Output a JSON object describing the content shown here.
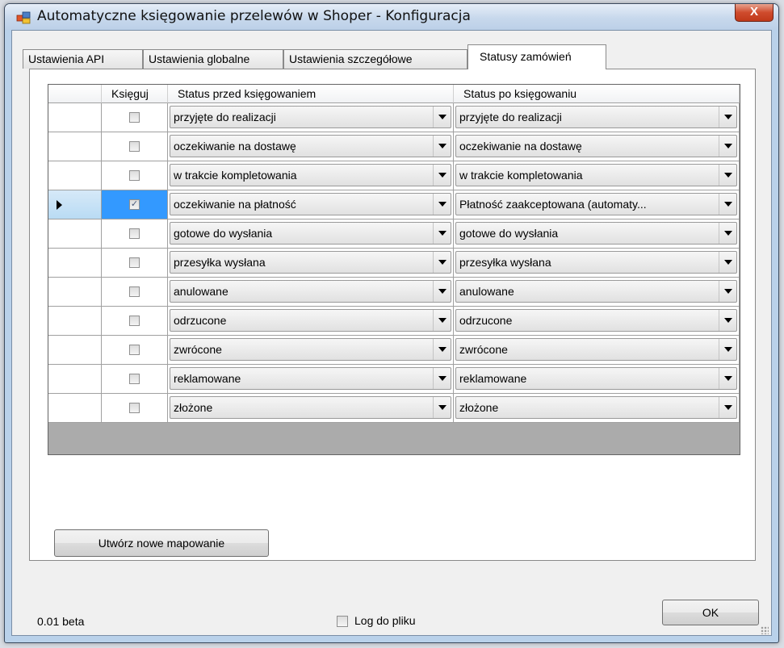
{
  "window": {
    "title": "Automatyczne księgowanie przelewów w Shoper - Konfiguracja",
    "close_label": "X",
    "accent": "#3399ff"
  },
  "tabs": [
    {
      "label": "Ustawienia API",
      "active": false
    },
    {
      "label": "Ustawienia globalne",
      "active": false
    },
    {
      "label": "Ustawienia szczegółowe",
      "active": false
    },
    {
      "label": "Statusy zamówień",
      "active": true
    }
  ],
  "grid": {
    "columns": [
      "Księguj",
      "Status przed księgowaniem",
      "Status po księgowaniu"
    ],
    "rows": [
      {
        "checked": false,
        "selected": false,
        "before": "przyjęte do realizacji",
        "after": "przyjęte do realizacji"
      },
      {
        "checked": false,
        "selected": false,
        "before": "oczekiwanie na dostawę",
        "after": "oczekiwanie na dostawę"
      },
      {
        "checked": false,
        "selected": false,
        "before": "w trakcie kompletowania",
        "after": "w trakcie kompletowania"
      },
      {
        "checked": true,
        "selected": true,
        "before": "oczekiwanie na płatność",
        "after": "Płatność zaakceptowana (automaty..."
      },
      {
        "checked": false,
        "selected": false,
        "before": "gotowe do wysłania",
        "after": "gotowe do wysłania"
      },
      {
        "checked": false,
        "selected": false,
        "before": "przesyłka wysłana",
        "after": "przesyłka wysłana"
      },
      {
        "checked": false,
        "selected": false,
        "before": "anulowane",
        "after": "anulowane"
      },
      {
        "checked": false,
        "selected": false,
        "before": "odrzucone",
        "after": "odrzucone"
      },
      {
        "checked": false,
        "selected": false,
        "before": "zwrócone",
        "after": "zwrócone"
      },
      {
        "checked": false,
        "selected": false,
        "before": "reklamowane",
        "after": "reklamowane"
      },
      {
        "checked": false,
        "selected": false,
        "before": "złożone",
        "after": "złożone"
      }
    ]
  },
  "buttons": {
    "new_mapping": "Utwórz nowe mapowanie",
    "ok": "OK"
  },
  "footer": {
    "version": "0.01 beta",
    "log_label": "Log do pliku",
    "log_checked": false
  }
}
